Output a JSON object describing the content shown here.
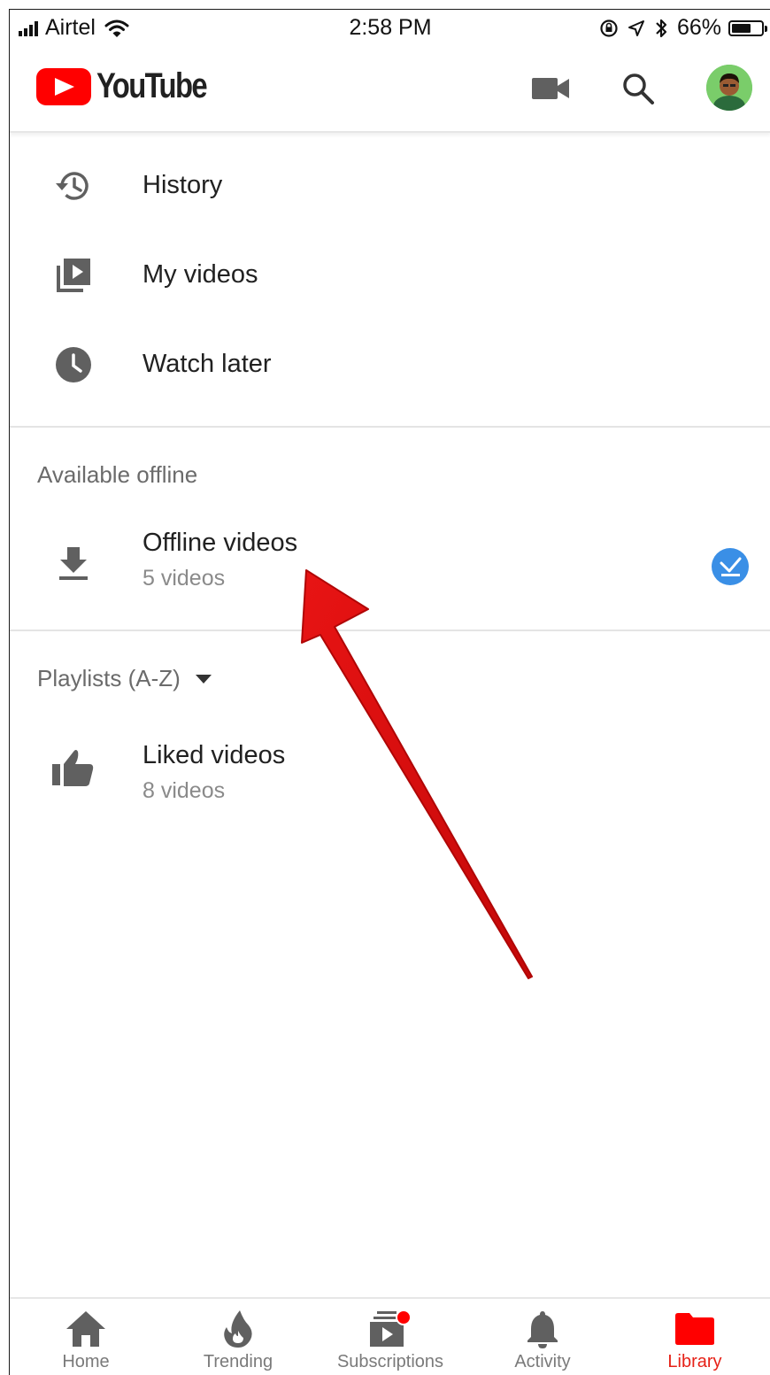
{
  "status_bar": {
    "carrier": "Airtel",
    "time": "2:58 PM",
    "battery": "66%",
    "battery_level": 0.66
  },
  "app_bar": {
    "logo_text": "YouTube",
    "icons": [
      "video-camera-icon",
      "search-icon",
      "avatar"
    ]
  },
  "library": {
    "items": [
      {
        "label": "History",
        "icon": "history-icon"
      },
      {
        "label": "My videos",
        "icon": "my-videos-icon"
      },
      {
        "label": "Watch later",
        "icon": "clock-icon"
      }
    ],
    "offline": {
      "header": "Available offline",
      "title": "Offline videos",
      "count": "5 videos",
      "icon": "download-icon",
      "badge_icon": "check-badge-icon"
    },
    "playlists": {
      "header": "Playlists (A-Z)",
      "items": [
        {
          "title": "Liked videos",
          "count": "8 videos",
          "icon": "thumbs-up-icon"
        }
      ]
    }
  },
  "bottom_nav": {
    "items": [
      {
        "label": "Home",
        "icon": "home-icon"
      },
      {
        "label": "Trending",
        "icon": "flame-icon"
      },
      {
        "label": "Subscriptions",
        "icon": "subscriptions-icon"
      },
      {
        "label": "Activity",
        "icon": "bell-icon"
      },
      {
        "label": "Library",
        "icon": "folder-icon"
      }
    ],
    "active": "Library"
  },
  "colors": {
    "brand_red": "#ff0000",
    "active_tab": "#e62117",
    "check_blue": "#3a8fe6",
    "annotation_arrow": "#d40d0d"
  }
}
